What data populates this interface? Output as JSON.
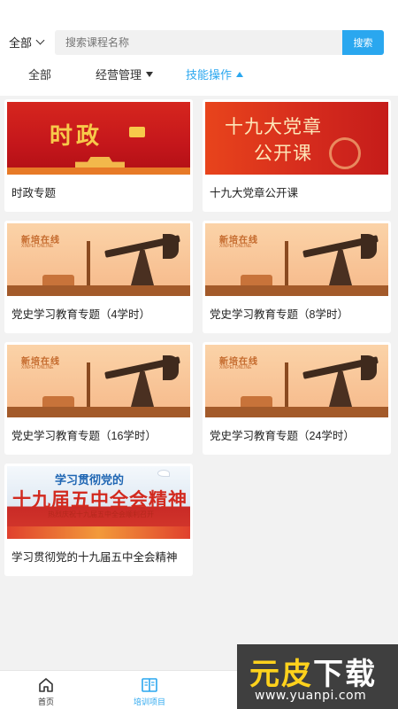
{
  "search": {
    "scope_label": "全部",
    "placeholder": "搜索课程名称",
    "button_label": "搜索"
  },
  "filter_tabs": [
    {
      "label": "全部",
      "active": false
    },
    {
      "label": "经营管理",
      "active": false
    },
    {
      "label": "技能操作",
      "active": true
    }
  ],
  "courses": [
    {
      "title": "时政专题",
      "thumb_text": [
        "时政"
      ]
    },
    {
      "title": "十九大党章公开课",
      "thumb_text": [
        "十九大党章",
        "公开课"
      ]
    },
    {
      "title": "党史学习教育专题（4学时）",
      "thumb_text": [
        "新培在线",
        "XINPEI ONLINE"
      ]
    },
    {
      "title": "党史学习教育专题（8学时）",
      "thumb_text": [
        "新培在线",
        "XINPEI ONLINE"
      ]
    },
    {
      "title": "党史学习教育专题（16学时）",
      "thumb_text": [
        "新培在线",
        "XINPEI ONLINE"
      ]
    },
    {
      "title": "党史学习教育专题（24学时）",
      "thumb_text": [
        "新培在线",
        "XINPEI ONLINE"
      ]
    },
    {
      "title": "学习贯彻党的十九届五中全会精神",
      "thumb_text": [
        "学习贯彻党的",
        "十九届五中全会精神",
        "热烈庆祝十九届五中全会顺利召开"
      ]
    }
  ],
  "bottom_nav": [
    {
      "label": "首页",
      "icon": "home-icon",
      "active": false
    },
    {
      "label": "培训项目",
      "icon": "book-icon",
      "active": true
    },
    {
      "label": "",
      "icon": "",
      "active": false
    },
    {
      "label": "",
      "icon": "",
      "active": false
    }
  ],
  "watermark": {
    "word1": "元皮",
    "word2": "下载",
    "url": "www.yuanpi.com"
  },
  "colors": {
    "accent": "#2aa7ef",
    "background": "#f2f2f2"
  }
}
